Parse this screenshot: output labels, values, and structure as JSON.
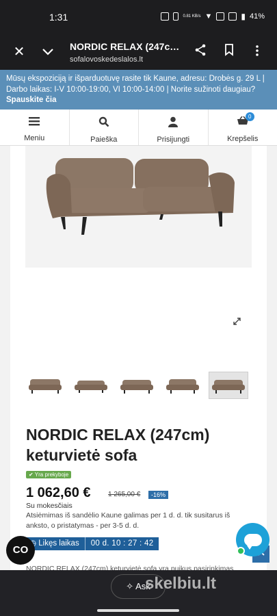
{
  "status_bar": {
    "time": "1:31",
    "network_speed": "0.81\nKB/s",
    "battery": "41%"
  },
  "browser": {
    "title": "NORDIC RELAX (247cm...",
    "url": "sofalovoskedeslalos.lt",
    "close_icon": "close-icon",
    "menu_chevron": "chevron-down-icon"
  },
  "banner": {
    "text": "Mūsų ekspoziciją ir išparduotuvę rasite tik Kaune, adresu: Drobės g. 29 L | Darbo laikas: I-V 10:00-19:00, VI 10:00-14:00 | Norite sužinoti daugiau?",
    "link": "Spauskite čia"
  },
  "nav": {
    "items": [
      {
        "label": "Meniu",
        "icon": "hamburger-icon"
      },
      {
        "label": "Paieška",
        "icon": "search-icon"
      },
      {
        "label": "Prisijungti",
        "icon": "user-icon"
      },
      {
        "label": "Krepšelis",
        "icon": "cart-icon",
        "badge": "0"
      }
    ]
  },
  "product": {
    "title": "NORDIC RELAX (247cm) keturvietė sofa",
    "stock": "Yra prekyboje",
    "price": "1 062,60 €",
    "old_price": "1 265,00 €",
    "discount": "-16%",
    "tax_note": "Su mokesčiais",
    "pickup_note": "Atsiėmimas iš sandėlio Kaune galimas per 1 d. d. tik susitarus iš anksto, o pristatymas - per 3-5 d. d.",
    "timer_label": "Likęs laikas",
    "timer_value": "00 d. 10 : 27 : 42",
    "description_start": "NORDIC RELAX (247cm) keturvietė sofa yra puikus pasirinkimas"
  },
  "widgets": {
    "co_label": "CO",
    "ask_label": "Ask",
    "watermark": "skelbiu.lt"
  },
  "colors": {
    "banner": "#5b8fb8",
    "accent": "#2d6ea8",
    "stock": "#67a84c",
    "chat": "#1da1d8",
    "sofa": "#8a7462"
  }
}
